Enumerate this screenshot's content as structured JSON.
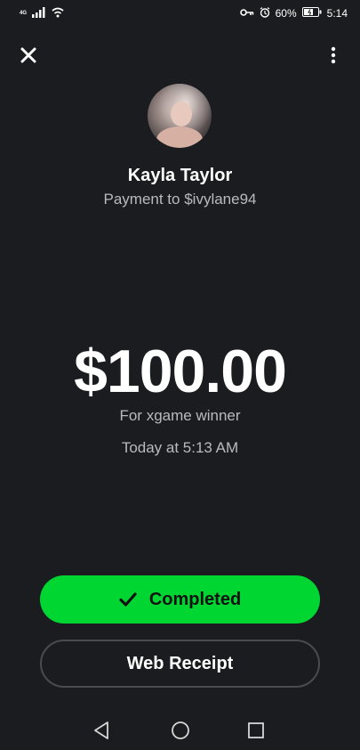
{
  "status_bar": {
    "network_label": "4G",
    "battery_percent": "60%",
    "time": "5:14",
    "icons": [
      "signal-icon",
      "wifi-icon",
      "key-icon",
      "alarm-icon",
      "battery-icon"
    ]
  },
  "header": {
    "close_icon": "close-icon",
    "more_icon": "more-vertical-icon"
  },
  "recipient": {
    "name": "Kayla Taylor",
    "subtitle": "Payment to $ivylane94"
  },
  "payment": {
    "amount": "$100.00",
    "note": "For xgame winner",
    "timestamp": "Today at 5:13 AM"
  },
  "actions": {
    "status_label": "Completed",
    "status_icon": "check-icon",
    "receipt_label": "Web Receipt"
  },
  "nav_bar": {
    "icons": [
      "back-icon",
      "home-icon",
      "recents-icon"
    ]
  },
  "colors": {
    "background": "#1b1c1f",
    "accent_green": "#00d632",
    "muted_text": "#b9babd",
    "outline": "#4a4b4f"
  }
}
